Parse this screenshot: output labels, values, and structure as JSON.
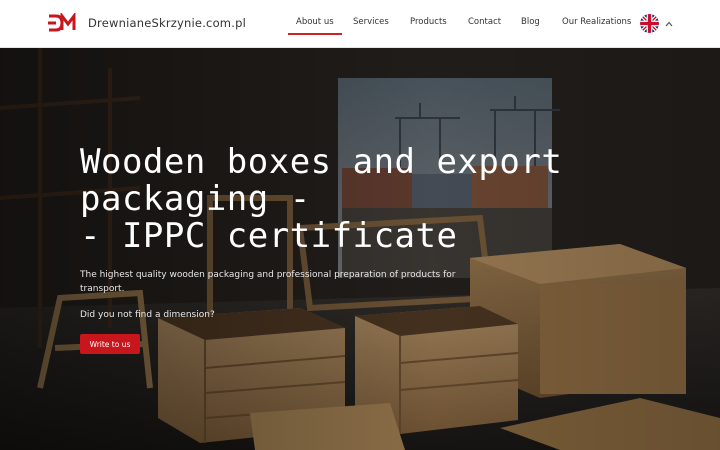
{
  "site": {
    "logo_text": "DrewnianeSkrzynie.com.pl",
    "brand_color": "#c8161d"
  },
  "nav": {
    "items": [
      {
        "label": "About us",
        "active": true
      },
      {
        "label": "Services",
        "active": false
      },
      {
        "label": "Products",
        "active": false
      },
      {
        "label": "Contact",
        "active": false
      },
      {
        "label": "Blog",
        "active": false
      },
      {
        "label": "Our Realizations",
        "active": false
      }
    ],
    "language_icon": "uk-flag-icon"
  },
  "hero": {
    "title": "Wooden boxes and export\npackaging -\n- IPPC certificate",
    "subtitle": "The highest quality wooden packaging and professional preparation of products for transport.",
    "question": "Did you not find a dimension?",
    "cta_label": "Write to us"
  }
}
